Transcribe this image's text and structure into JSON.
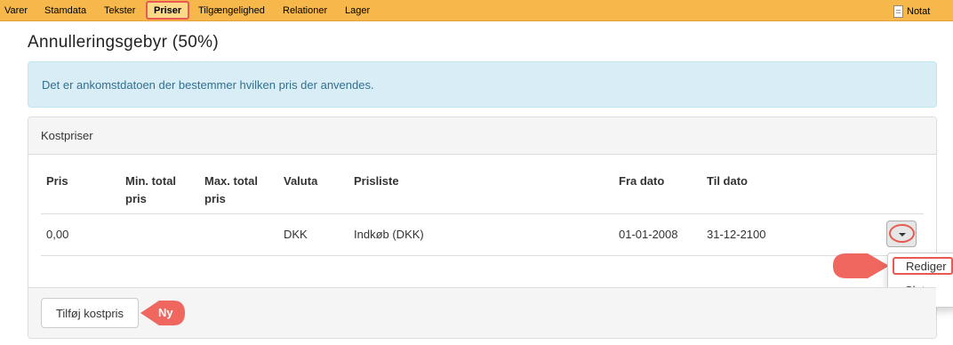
{
  "tabs": [
    {
      "label": "Varer",
      "active": false
    },
    {
      "label": "Stamdata",
      "active": false
    },
    {
      "label": "Tekster",
      "active": false
    },
    {
      "label": "Priser",
      "active": true
    },
    {
      "label": "Tilgængelighed",
      "active": false
    },
    {
      "label": "Relationer",
      "active": false
    },
    {
      "label": "Lager",
      "active": false
    }
  ],
  "notat_label": "Notat",
  "page_title": "Annulleringsgebyr (50%)",
  "info_alert": "Det er ankomstdatoen der bestemmer hvilken pris der anvendes.",
  "panel": {
    "heading": "Kostpriser",
    "columns": [
      "Pris",
      "Min. total pris",
      "Max. total pris",
      "Valuta",
      "Prisliste",
      "Fra dato",
      "Til dato"
    ],
    "rows": [
      {
        "pris": "0,00",
        "min_total": "",
        "max_total": "",
        "valuta": "DKK",
        "prisliste": "Indkøb (DKK)",
        "fra_dato": "01-01-2008",
        "til_dato": "31-12-2100"
      }
    ],
    "row_menu": {
      "edit": "Rediger",
      "delete": "Slet"
    },
    "add_button": "Tilføj kostpris"
  },
  "annotations": {
    "new_label": "Ny"
  },
  "colors": {
    "tabbar": "#f6b84b",
    "highlight": "#e85a4f",
    "alert_bg": "#d9edf7",
    "alert_text": "#31708f"
  }
}
